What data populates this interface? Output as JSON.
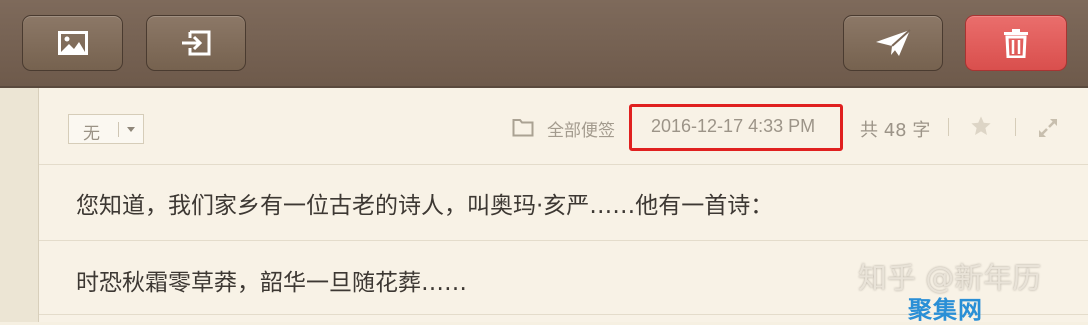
{
  "toolbar": {
    "buttons": [
      {
        "name": "insert-image",
        "icon": "image-icon"
      },
      {
        "name": "insert-file",
        "icon": "import-icon"
      },
      {
        "name": "send",
        "icon": "paper-plane-icon"
      },
      {
        "name": "delete",
        "icon": "trash-icon",
        "color": "#e05e5c"
      }
    ]
  },
  "meta": {
    "tag_value": "无",
    "folder_label": "全部便签",
    "timestamp": "2016-12-17 4:33 PM",
    "word_count": "共 48 字",
    "highlight_color": "#e0201f"
  },
  "content": {
    "lines": [
      "您知道，我们家乡有一位古老的诗人，叫奥玛·亥严……他有一首诗：",
      "时恐秋霜零草莽，韶华一旦随花葬……"
    ]
  },
  "watermarks": {
    "zhihu": "知乎 @新年历",
    "site": "聚集网"
  }
}
